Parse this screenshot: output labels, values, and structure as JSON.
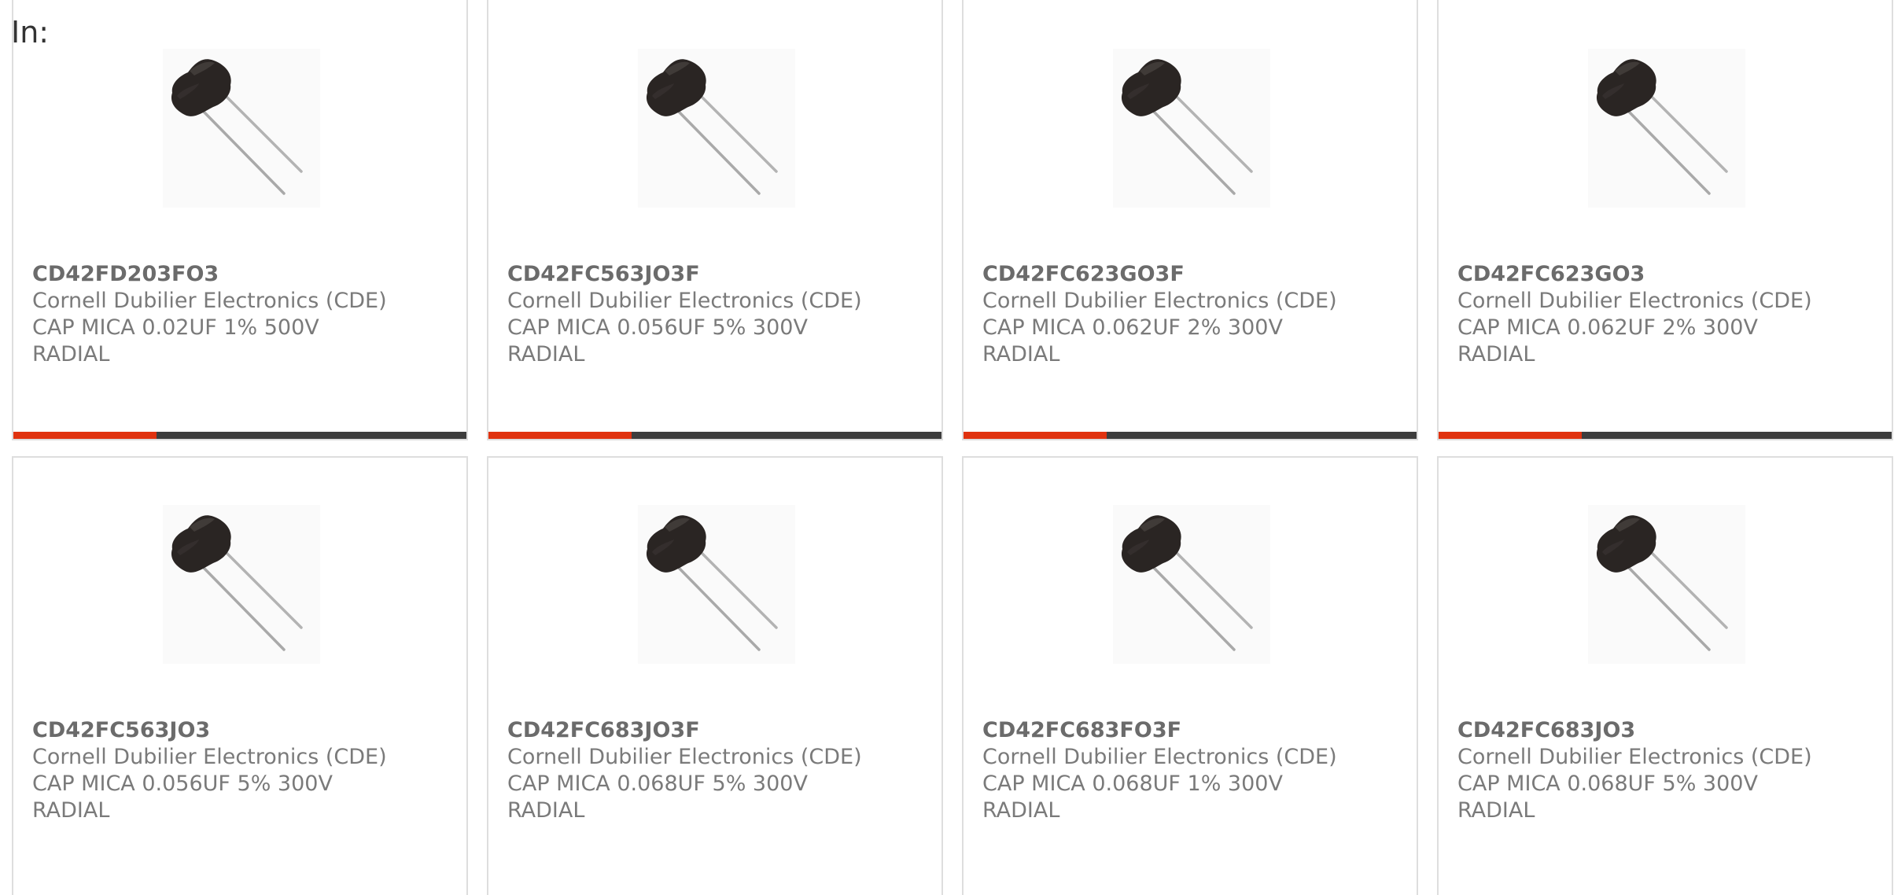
{
  "header": {
    "in_label": "In:"
  },
  "colors": {
    "accent": "#e0320f",
    "bar": "#3d3d3d",
    "border": "#dedede",
    "text": "#757575"
  },
  "products": [
    {
      "part_number": "CD42FD203FO3",
      "manufacturer": "Cornell Dubilier Electronics (CDE)",
      "desc_line1": "CAP MICA 0.02UF 1% 500V",
      "desc_line2": "RADIAL",
      "image_icon": "mica-capacitor-icon"
    },
    {
      "part_number": "CD42FC563JO3F",
      "manufacturer": "Cornell Dubilier Electronics (CDE)",
      "desc_line1": "CAP MICA 0.056UF 5% 300V",
      "desc_line2": "RADIAL",
      "image_icon": "mica-capacitor-icon"
    },
    {
      "part_number": "CD42FC623GO3F",
      "manufacturer": "Cornell Dubilier Electronics (CDE)",
      "desc_line1": "CAP MICA 0.062UF 2% 300V",
      "desc_line2": "RADIAL",
      "image_icon": "mica-capacitor-icon"
    },
    {
      "part_number": "CD42FC623GO3",
      "manufacturer": "Cornell Dubilier Electronics (CDE)",
      "desc_line1": "CAP MICA 0.062UF 2% 300V",
      "desc_line2": "RADIAL",
      "image_icon": "mica-capacitor-icon"
    },
    {
      "part_number": "CD42FC563JO3",
      "manufacturer": "Cornell Dubilier Electronics (CDE)",
      "desc_line1": "CAP MICA 0.056UF 5% 300V",
      "desc_line2": "RADIAL",
      "image_icon": "mica-capacitor-icon"
    },
    {
      "part_number": "CD42FC683JO3F",
      "manufacturer": "Cornell Dubilier Electronics (CDE)",
      "desc_line1": "CAP MICA 0.068UF 5% 300V",
      "desc_line2": "RADIAL",
      "image_icon": "mica-capacitor-icon"
    },
    {
      "part_number": "CD42FC683FO3F",
      "manufacturer": "Cornell Dubilier Electronics (CDE)",
      "desc_line1": "CAP MICA 0.068UF 1% 300V",
      "desc_line2": "RADIAL",
      "image_icon": "mica-capacitor-icon"
    },
    {
      "part_number": "CD42FC683JO3",
      "manufacturer": "Cornell Dubilier Electronics (CDE)",
      "desc_line1": "CAP MICA 0.068UF 5% 300V",
      "desc_line2": "RADIAL",
      "image_icon": "mica-capacitor-icon"
    }
  ]
}
